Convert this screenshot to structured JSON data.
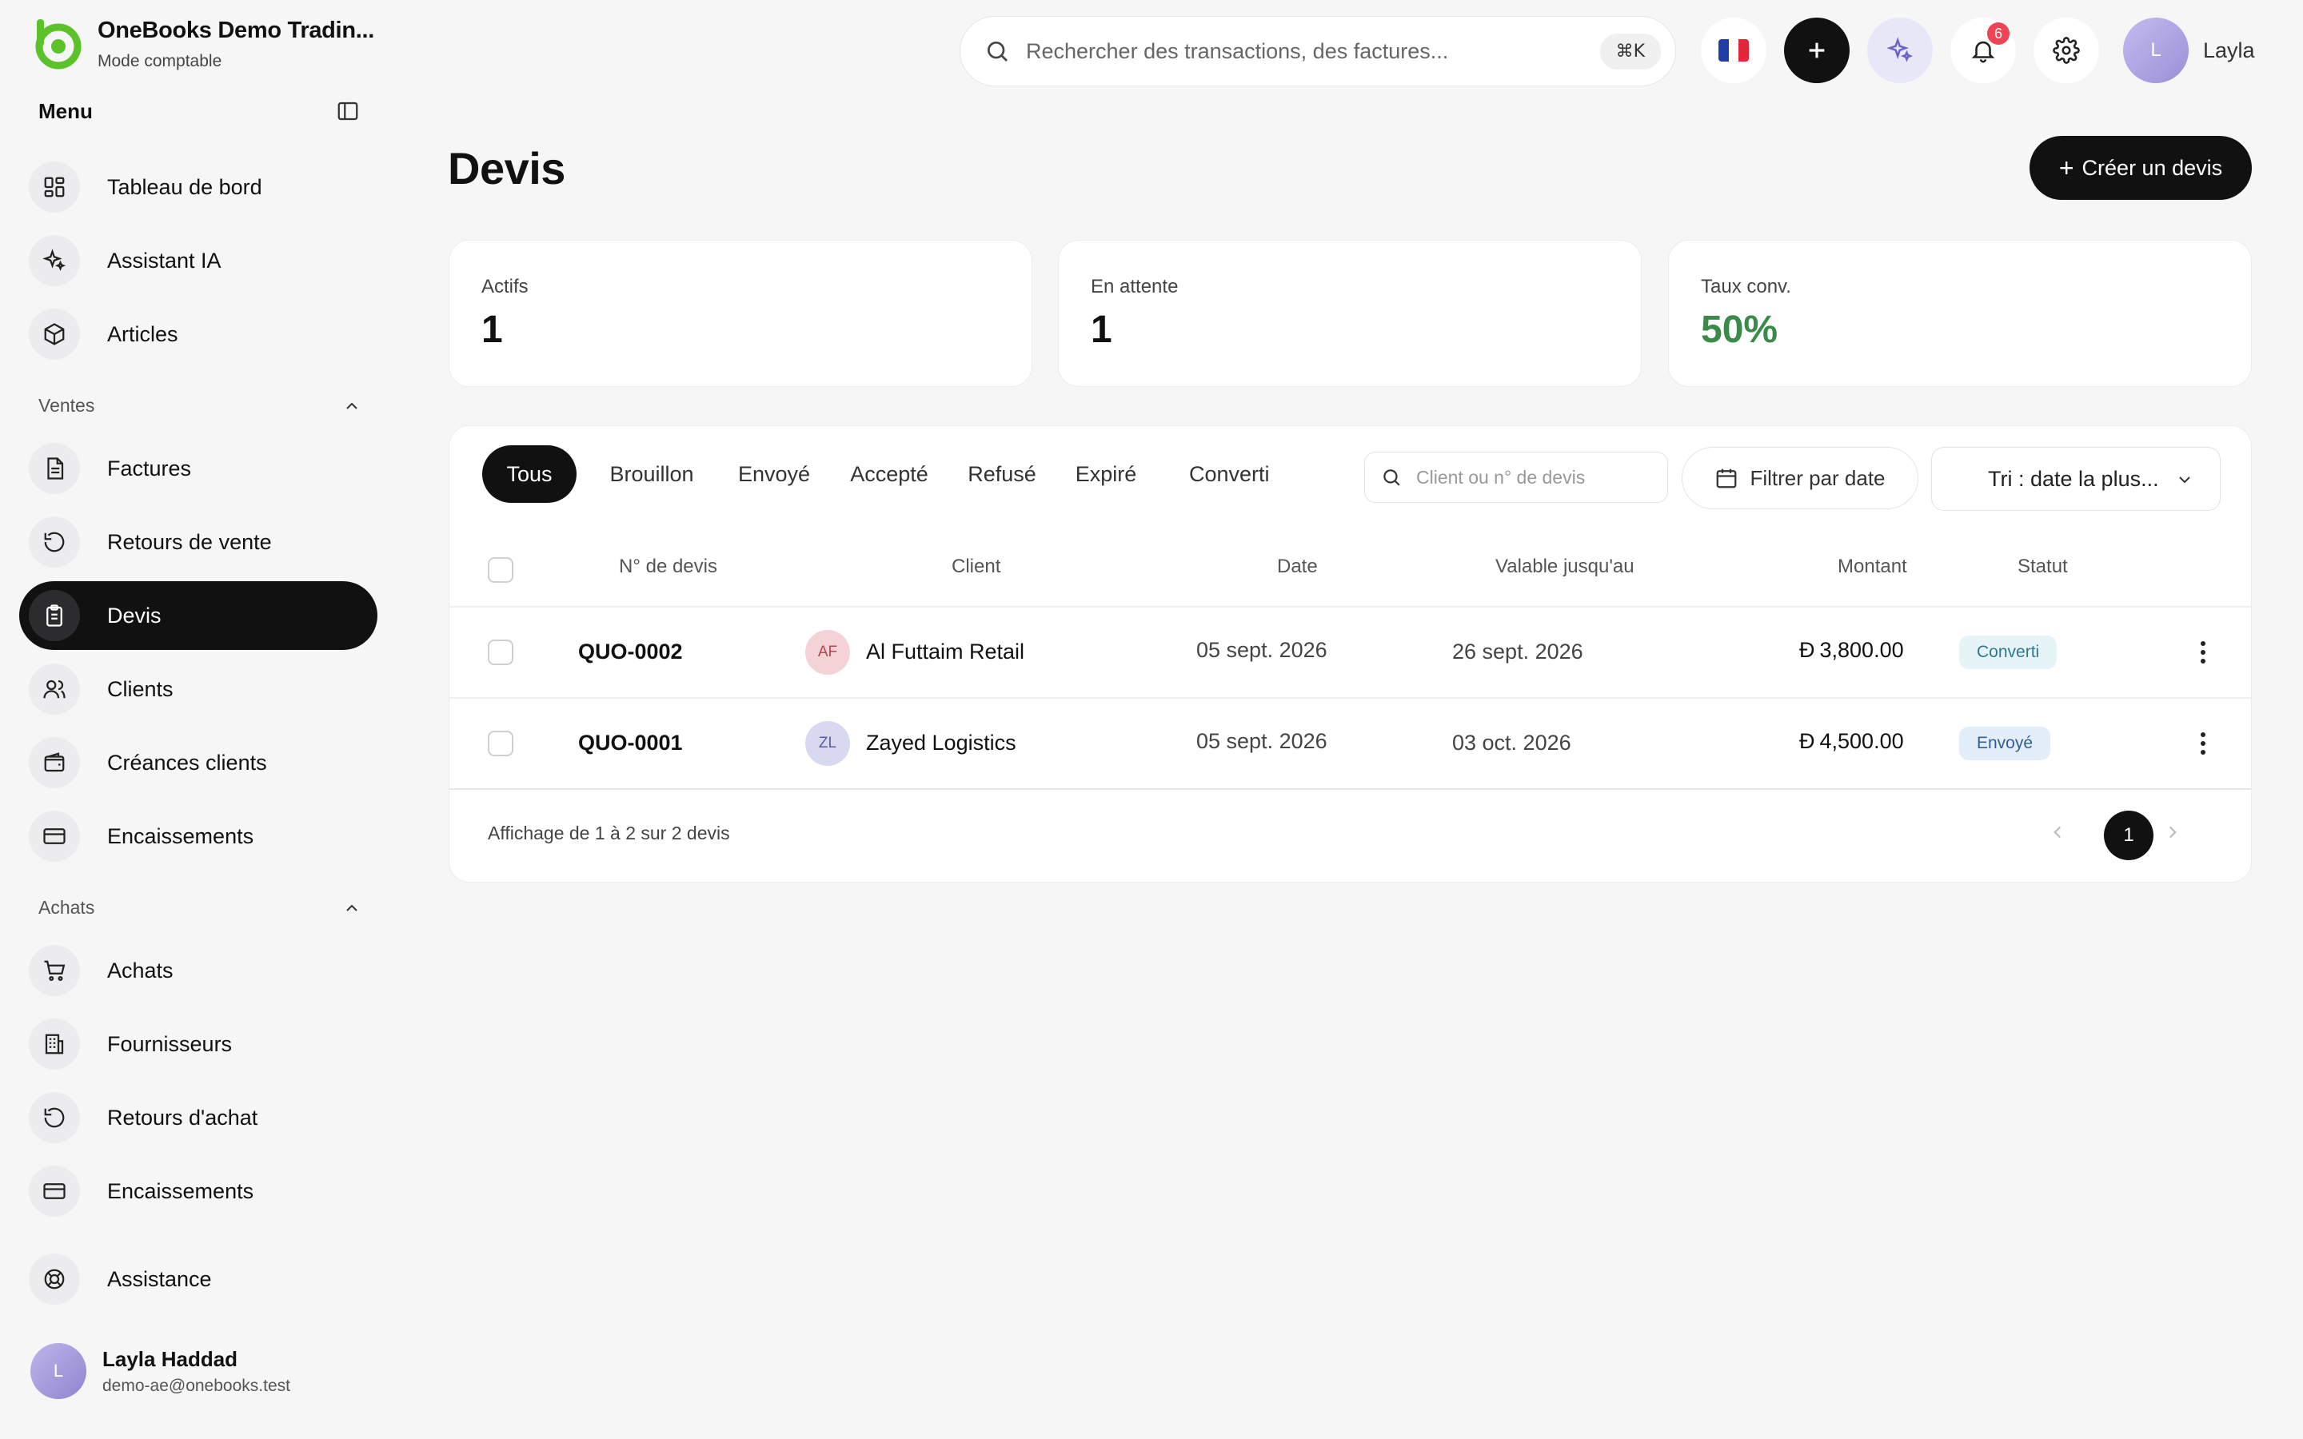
{
  "sidebar": {
    "brand_name": "OneBooks Demo Tradin...",
    "brand_mode": "Mode comptable",
    "menu_title": "Menu",
    "items_top": [
      {
        "label": "Tableau de bord",
        "icon": "dashboard-icon"
      },
      {
        "label": "Assistant IA",
        "icon": "sparkles-icon"
      },
      {
        "label": "Articles",
        "icon": "package-icon"
      }
    ],
    "sales_title": "Ventes",
    "sales_items": [
      {
        "label": "Factures",
        "icon": "invoice-icon"
      },
      {
        "label": "Retours de vente",
        "icon": "undo-icon"
      },
      {
        "label": "Devis",
        "icon": "clipboard-icon",
        "active": true
      },
      {
        "label": "Clients",
        "icon": "users-icon"
      },
      {
        "label": "Créances clients",
        "icon": "wallet-icon"
      },
      {
        "label": "Encaissements",
        "icon": "card-icon"
      }
    ],
    "purchases_title": "Achats",
    "purchase_items": [
      {
        "label": "Achats",
        "icon": "cart-icon"
      },
      {
        "label": "Fournisseurs",
        "icon": "building-icon"
      },
      {
        "label": "Retours d'achat",
        "icon": "undo-icon"
      },
      {
        "label": "Encaissements",
        "icon": "card-icon"
      }
    ],
    "support_label": "Assistance",
    "user": {
      "initial": "L",
      "name": "Layla Haddad",
      "email": "demo-ae@onebooks.test"
    }
  },
  "topbar": {
    "search_placeholder": "Rechercher des transactions, des factures...",
    "shortcut": "⌘K",
    "notification_count": "6",
    "user_initial": "L",
    "user_name": "Layla"
  },
  "page": {
    "title": "Devis",
    "create_button": "Créer un devis"
  },
  "stats": [
    {
      "label": "Actifs",
      "value": "1"
    },
    {
      "label": "En attente",
      "value": "1"
    },
    {
      "label": "Taux conv.",
      "value": "50%"
    }
  ],
  "tabs": [
    "Tous",
    "Brouillon",
    "Envoyé",
    "Accepté",
    "Refusé",
    "Expiré",
    "Converti"
  ],
  "filters": {
    "search_placeholder": "Client ou n° de devis",
    "date_button": "Filtrer par date",
    "sort_label": "Tri : date la plus..."
  },
  "table": {
    "columns": [
      "N° de devis",
      "Client",
      "Date",
      "Valable jusqu'au",
      "Montant",
      "Statut"
    ],
    "rows": [
      {
        "number": "QUO-0002",
        "initials": "AF",
        "client": "Al Futtaim Retail",
        "date": "05 sept. 2026",
        "valid_until": "26 sept. 2026",
        "currency": "Đ",
        "amount": "3,800.00",
        "status": "Converti"
      },
      {
        "number": "QUO-0001",
        "initials": "ZL",
        "client": "Zayed Logistics",
        "date": "05 sept. 2026",
        "valid_until": "03 oct. 2026",
        "currency": "Đ",
        "amount": "4,500.00",
        "status": "Envoyé"
      }
    ],
    "footer": "Affichage de 1 à 2 sur 2 devis",
    "current_page": "1"
  },
  "colors": {
    "accent_green": "#3a8a4a",
    "brand_green": "#5cc22a",
    "dark": "#111111",
    "badge_red": "#ef4455"
  }
}
